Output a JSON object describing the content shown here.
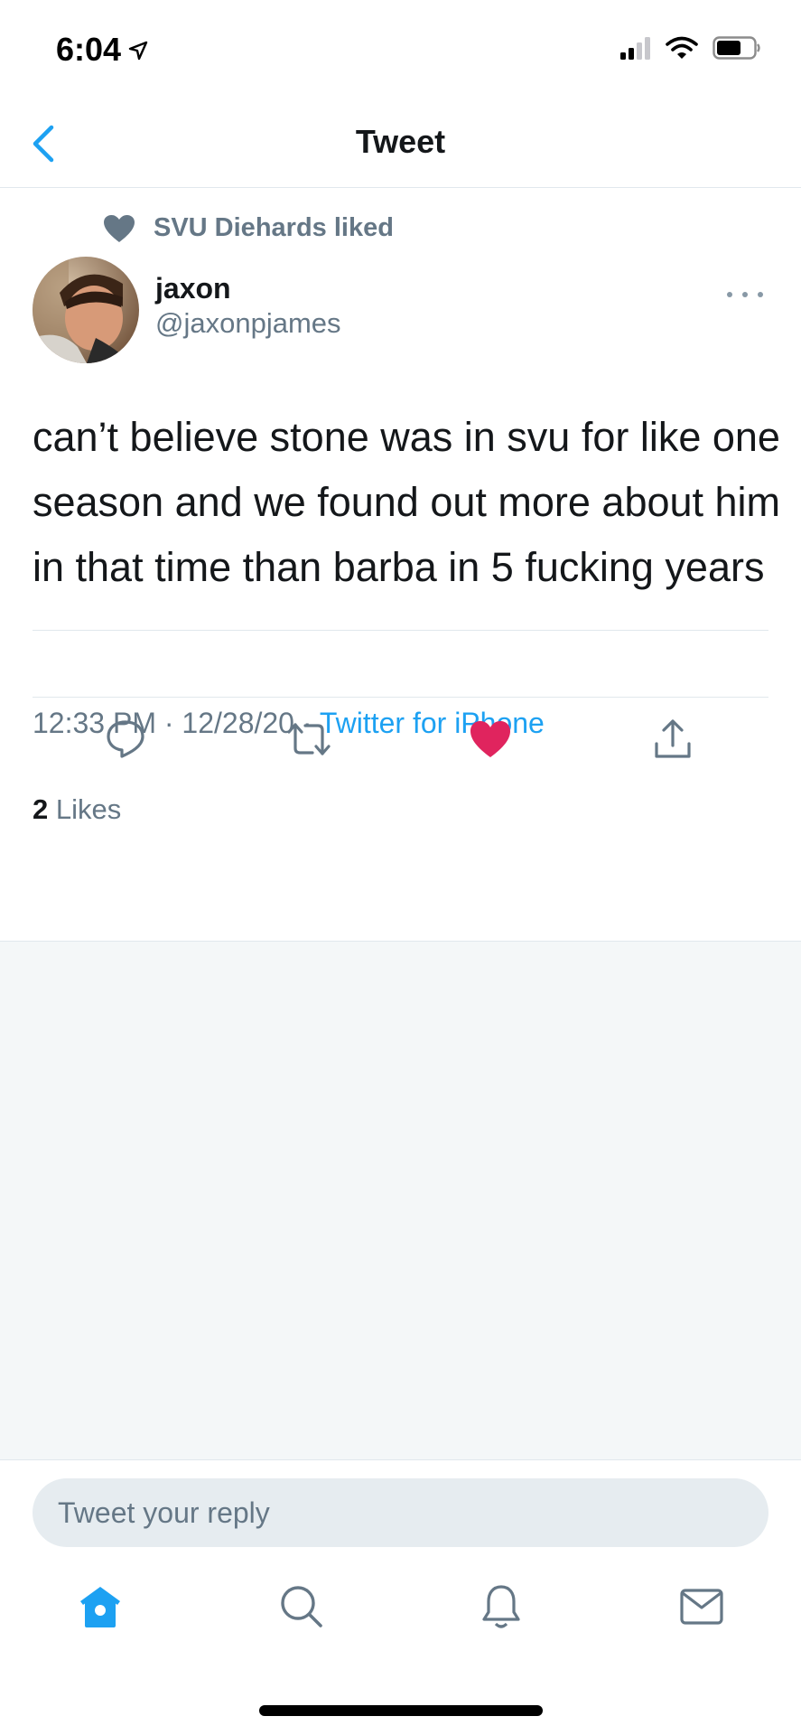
{
  "status_bar": {
    "time": "6:04",
    "icons": [
      "location-arrow-icon",
      "signal-icon",
      "wifi-icon",
      "battery-icon"
    ]
  },
  "header": {
    "title": "Tweet",
    "back_icon": "chevron-left-icon"
  },
  "tweet": {
    "social_context": "SVU Diehards liked",
    "author_name": "jaxon",
    "author_handle": "@jaxonpjames",
    "text": "can’t believe stone was in svu for like one season and we found out more about him in that time than barba in 5 fucking years",
    "time": "12:33 PM",
    "date": "12/28/20",
    "separator": "·",
    "source": "Twitter for iPhone",
    "likes_count": "2",
    "likes_label": "Likes",
    "liked": true
  },
  "actions": [
    {
      "name": "reply-icon"
    },
    {
      "name": "retweet-icon"
    },
    {
      "name": "like-icon"
    },
    {
      "name": "share-icon"
    }
  ],
  "reply": {
    "placeholder": "Tweet your reply"
  },
  "tabbar": {
    "items": [
      {
        "name": "home-icon",
        "active": true
      },
      {
        "name": "search-icon",
        "active": false
      },
      {
        "name": "notifications-icon",
        "active": false
      },
      {
        "name": "messages-icon",
        "active": false
      }
    ]
  },
  "colors": {
    "accent": "#1da1f2",
    "like": "#e0245e",
    "muted": "#657786",
    "background_gray": "#f4f7f8"
  }
}
